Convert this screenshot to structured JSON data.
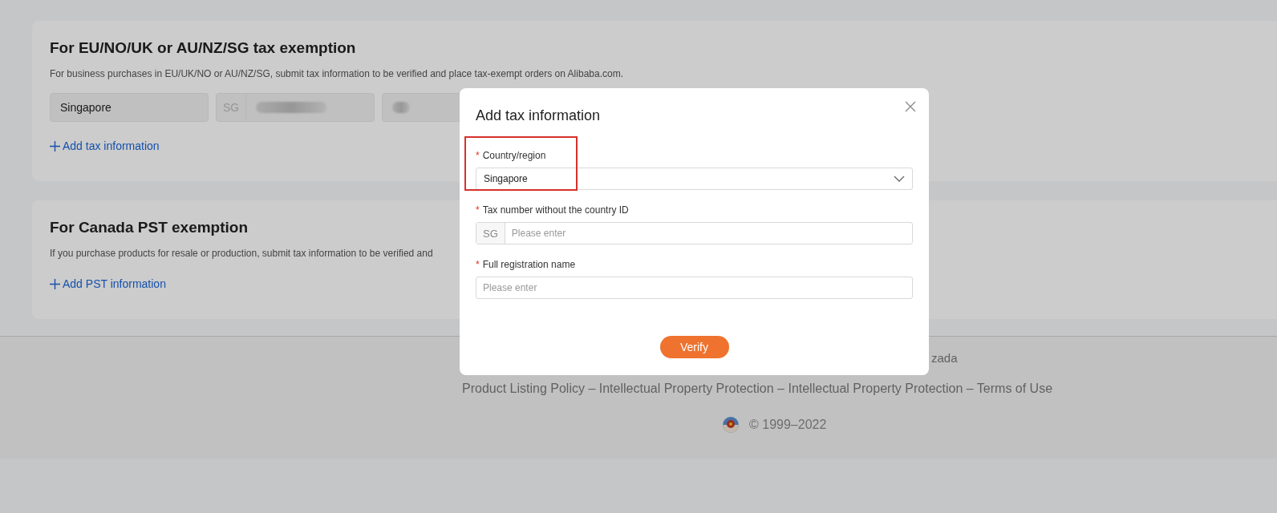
{
  "sections": [
    {
      "title": "For EU/NO/UK or AU/NZ/SG tax exemption",
      "description": "For business purchases in EU/UK/NO or AU/NZ/SG, submit tax information to be verified and place tax-exempt orders on Alibaba.com.",
      "entry": {
        "country": "Singapore",
        "prefix": "SG"
      },
      "link": "Add tax information"
    },
    {
      "title": "For Canada PST exemption",
      "description": "If you purchase products for resale or production, submit tax information to be verified and",
      "link": "Add PST information"
    }
  ],
  "footer": {
    "line_1": "zada",
    "links": "Product Listing Policy – Intellectual Property Protection – Intellectual Property Protection – Terms of Use",
    "copyright": "© 1999–2022"
  },
  "dialog": {
    "title": "Add tax information",
    "fields": [
      {
        "kind": "select",
        "label": "Country/region",
        "required_mark": "*",
        "value": "Singapore",
        "highlighted": true
      },
      {
        "kind": "prefixed",
        "label": "Tax number without the country ID",
        "required_mark": "*",
        "prefix": "SG",
        "placeholder": "Please enter",
        "highlighted": false
      },
      {
        "kind": "text",
        "label": "Full registration name",
        "required_mark": "*",
        "placeholder": "Please enter",
        "highlighted": false
      }
    ],
    "button": "Verify"
  }
}
